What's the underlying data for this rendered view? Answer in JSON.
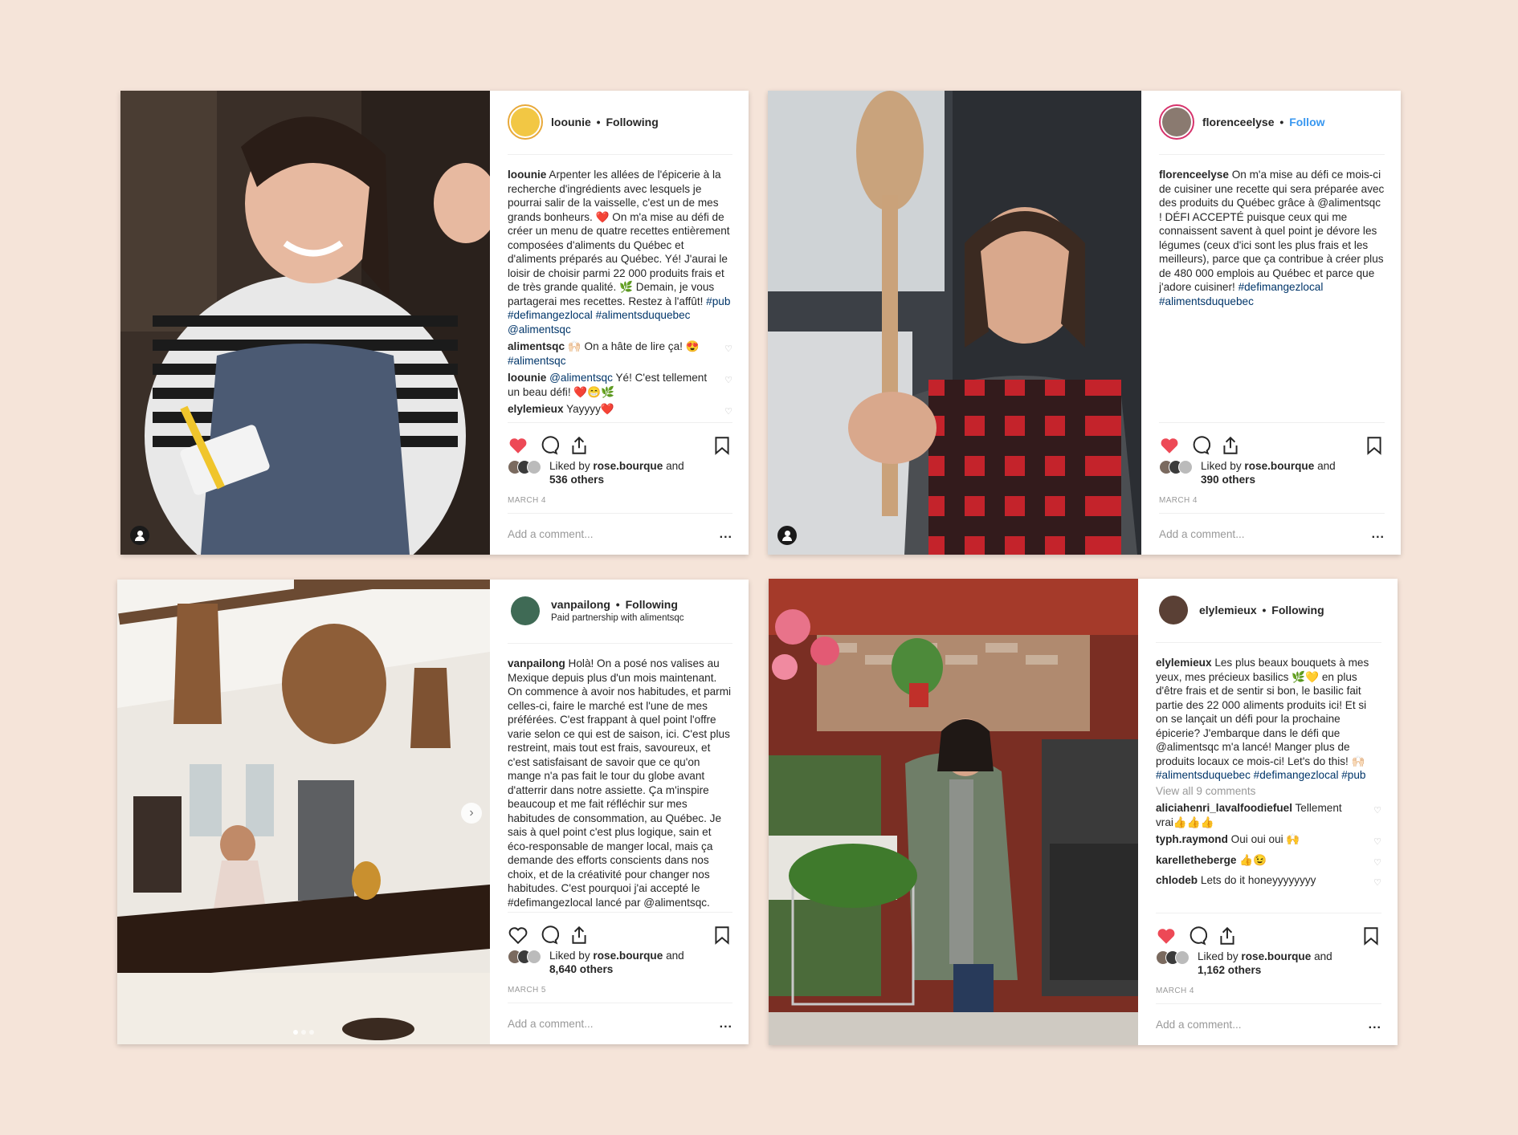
{
  "page": {
    "background": "#f5e4d9"
  },
  "posts": [
    {
      "username": "loounie",
      "separator": "•",
      "status": "Following",
      "subtitle": "",
      "caption_user": "loounie",
      "caption_text": "Arpenter les allées de l'épicerie à la recherche d'ingrédients avec lesquels je pourrai salir de la vaisselle, c'est un de mes grands bonheurs. ❤️ On m'a mise au défi de créer un menu de quatre recettes entièrement composées d'aliments du Québec et d'aliments préparés au Québec. Yé! J'aurai le loisir de choisir parmi 22 000 produits frais et de très grande qualité. 🌿 Demain, je vous partagerai mes recettes. Restez à l'affût!",
      "caption_tags": "#pub #defimangezlocal #alimentsduquebec @alimentsqc",
      "view_all": "",
      "comments": [
        {
          "user": "alimentsqc",
          "text": "🙌🏻 On a hâte de lire ça! 😍",
          "tag": "#alimentsqc"
        },
        {
          "user": "loounie",
          "text": "Yé! C'est tellement un beau défi! ❤️😁🌿",
          "tag": "@alimentsqc"
        },
        {
          "user": "elylemieux",
          "text": "Yayyyy❤️",
          "tag": ""
        }
      ],
      "liked": true,
      "likes_prefix": "Liked by",
      "likes_user": "rose.bourque",
      "likes_and": "and",
      "likes_others": "536 others",
      "date": "MARCH 4",
      "add_comment": "Add a comment...",
      "more": "..."
    },
    {
      "username": "florenceelyse",
      "separator": "•",
      "status": "Follow",
      "subtitle": "",
      "caption_user": "florenceelyse",
      "caption_text": "On m'a mise au défi ce mois-ci de cuisiner une recette qui sera préparée avec des produits du Québec grâce à @alimentsqc ! DÉFI ACCEPTÉ puisque ceux qui me connaissent savent à quel point je dévore les légumes (ceux d'ici sont les plus frais et les meilleurs), parce que ça contribue à créer plus de 480 000 emplois au Québec et parce que j'adore cuisiner!",
      "caption_tags": "#defimangezlocal #alimentsduquebec",
      "view_all": "",
      "comments": [],
      "liked": true,
      "likes_prefix": "Liked by",
      "likes_user": "rose.bourque",
      "likes_and": "and",
      "likes_others": "390 others",
      "date": "MARCH 4",
      "add_comment": "Add a comment...",
      "more": "..."
    },
    {
      "username": "vanpailong",
      "separator": "•",
      "status": "Following",
      "subtitle": "Paid partnership with alimentsqc",
      "caption_user": "vanpailong",
      "caption_text": "Holà! On a posé nos valises au Mexique depuis plus d'un mois maintenant. On commence à avoir nos habitudes, et parmi celles-ci, faire le marché est l'une de mes préférées. C'est frappant à quel point l'offre varie selon ce qui est de saison, ici. C'est plus restreint, mais tout est frais, savoureux, et c'est satisfaisant de savoir que ce qu'on mange n'a pas fait le tour du globe avant d'atterrir dans notre assiette. Ça m'inspire beaucoup et me fait réfléchir sur mes habitudes de consommation, au Québec. Je sais à quel point c'est plus logique, sain et éco-responsable de manger local, mais ça demande des efforts conscients dans nos choix, et de la créativité pour changer nos habitudes. C'est pourquoi j'ai accepté le #defimangezlocal lancé par @alimentsqc.",
      "caption_tags": "",
      "view_all": "",
      "comments": [],
      "liked": false,
      "likes_prefix": "Liked by",
      "likes_user": "rose.bourque",
      "likes_and": "and",
      "likes_others": "8,640 others",
      "date": "MARCH 5",
      "add_comment": "Add a comment...",
      "more": "..."
    },
    {
      "username": "elylemieux",
      "separator": "•",
      "status": "Following",
      "subtitle": "",
      "caption_user": "elylemieux",
      "caption_text": "Les plus beaux bouquets à mes yeux, mes précieux basilics 🌿💛 en plus d'être frais et de sentir si bon, le basilic fait partie des 22 000 aliments produits ici! Et si on se lançait un défi pour la prochaine épicerie? J'embarque dans le défi que @alimentsqc m'a lancé! Manger plus de produits locaux ce mois-ci! Let's do this! 🙌🏻",
      "caption_tags": "#alimentsduquebec #defimangezlocal #pub",
      "view_all": "View all 9 comments",
      "comments": [
        {
          "user": "aliciahenri_lavalfoodiefuel",
          "text": "Tellement vrai👍👍👍",
          "tag": ""
        },
        {
          "user": "typh.raymond",
          "text": "Oui oui oui 🙌",
          "tag": ""
        },
        {
          "user": "karelletheberge",
          "text": "👍😉",
          "tag": ""
        },
        {
          "user": "chlodeb",
          "text": "Lets do it honeyyyyyyyy",
          "tag": ""
        }
      ],
      "liked": true,
      "likes_prefix": "Liked by",
      "likes_user": "rose.bourque",
      "likes_and": "and",
      "likes_others": "1,162 others",
      "date": "MARCH 4",
      "add_comment": "Add a comment...",
      "more": "..."
    }
  ],
  "colors": {
    "heart": "#ed4956",
    "link": "#003569",
    "follow": "#3897f0",
    "avatar_ring": "#e8a93a"
  }
}
